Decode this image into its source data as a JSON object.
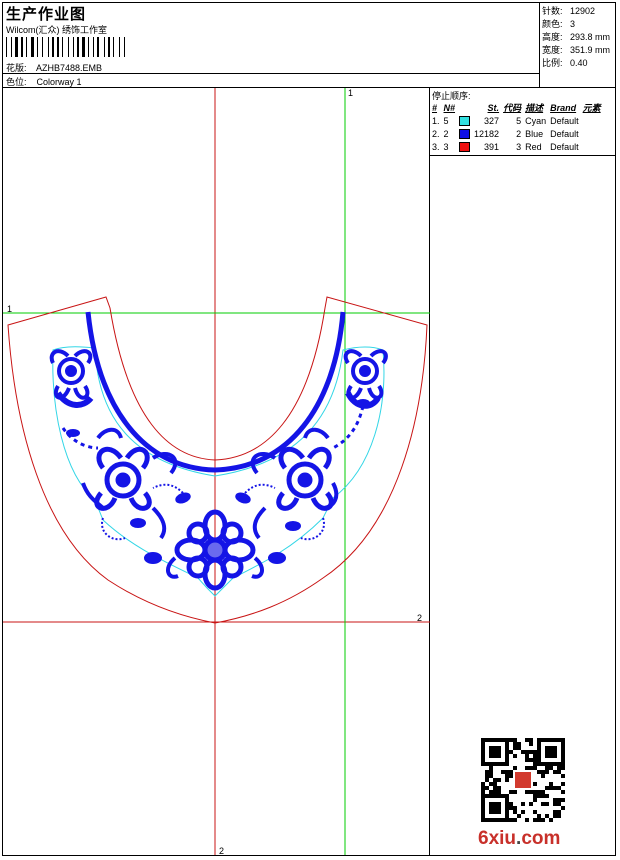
{
  "header": {
    "title": "生产作业图",
    "company": "Wilcom(汇众) 绣饰工作室",
    "design_label": "花版:",
    "design_value": "AZHB7488.EMB",
    "colorway_label": "色位:",
    "colorway_value": "Colorway 1"
  },
  "stats": {
    "stitches_label": "针数:",
    "stitches_value": "12902",
    "colors_label": "颜色:",
    "colors_value": "3",
    "height_label": "高度:",
    "height_value": "293.8 mm",
    "width_label": "宽度:",
    "width_value": "351.9 mm",
    "ratio_label": "比例:",
    "ratio_value": "0.40"
  },
  "stop_sequence": {
    "title": "停止顺序:",
    "headers": [
      "#",
      "N#",
      "St.",
      "代码",
      "描述",
      "Brand",
      "元素"
    ],
    "rows": [
      {
        "idx": "1.",
        "needle": "5",
        "color": "#33e0e0",
        "stitches": "327",
        "code": "5",
        "desc": "Cyan",
        "brand": "Default"
      },
      {
        "idx": "2.",
        "needle": "2",
        "color": "#1010e6",
        "stitches": "12182",
        "code": "2",
        "desc": "Blue",
        "brand": "Default"
      },
      {
        "idx": "3.",
        "needle": "3",
        "color": "#ee1010",
        "stitches": "391",
        "code": "3",
        "desc": "Red",
        "brand": "Default"
      }
    ]
  },
  "guides": {
    "top_label": "1",
    "left_label": "1",
    "right_label": "2",
    "bottom_label": "2"
  },
  "colors": {
    "cyan": "#33d6e6",
    "blue": "#1414e6",
    "red": "#c81414",
    "green": "#00cc00"
  },
  "watermark": {
    "text_main": "6xiu",
    "text_dot": ".",
    "text_tail": "com"
  }
}
